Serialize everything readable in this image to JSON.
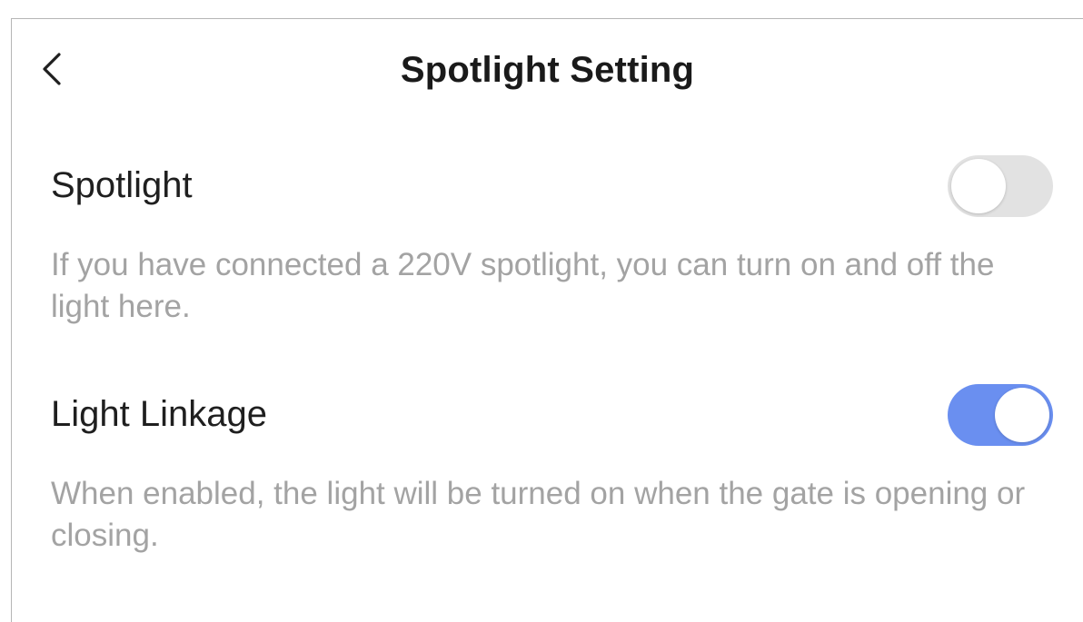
{
  "header": {
    "title": "Spotlight Setting",
    "back_icon": "chevron-left-icon"
  },
  "settings": [
    {
      "label": "Spotlight",
      "description": "If you have connected a 220V spotlight, you can turn on and off the light here.",
      "enabled": false
    },
    {
      "label": "Light Linkage",
      "description": "When enabled, the light will be turned on when the gate is opening or closing.",
      "enabled": true
    }
  ],
  "colors": {
    "toggle_on": "#6a8ff0",
    "toggle_off": "#e2e2e2",
    "description_text": "#a3a3a3",
    "primary_text": "#1f1f1f"
  }
}
